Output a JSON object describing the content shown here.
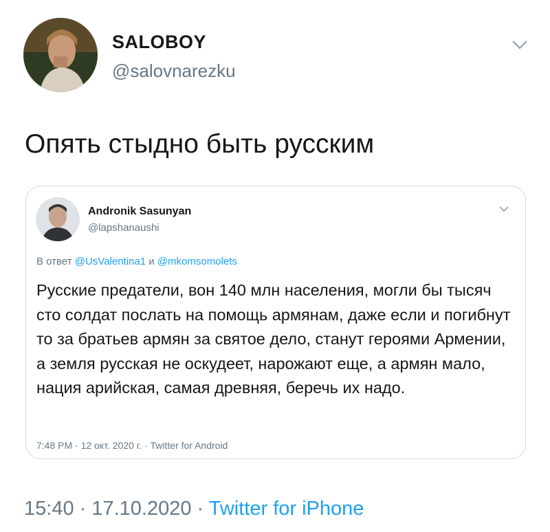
{
  "tweet": {
    "author": {
      "display_name": "SALOBOY",
      "handle": "@salovnarezku"
    },
    "text": "Опять стыдно быть русским",
    "timestamp": "15:40 · 17.10.2020",
    "separator": " · ",
    "source": "Twitter for iPhone"
  },
  "quoted_tweet": {
    "author": {
      "display_name": "Andronik Sasunyan",
      "handle": "@lapshanaushi"
    },
    "reply_prefix": "В ответ",
    "reply_to_1": "@UsValentina1",
    "reply_conjunction": "и",
    "reply_to_2": "@mkomsomolets",
    "text": "Русские предатели, вон 140 млн населения, могли бы тысяч сто солдат послать на помощь армянам, даже если и погибнут то за братьев армян за святое дело, станут героями Армении, а земля русская не оскудеет, нарожают еще, а армян мало, нация арийская, самая древняя, беречь их надо.",
    "meta": "7:48 PM · 12 окт. 2020 г. · Twitter for Android"
  },
  "icons": {
    "more": "chevron-down-icon"
  },
  "colors": {
    "link": "#1da1f2",
    "secondary_text": "#657786",
    "primary_text": "#14171a",
    "border": "#cfd9de"
  }
}
